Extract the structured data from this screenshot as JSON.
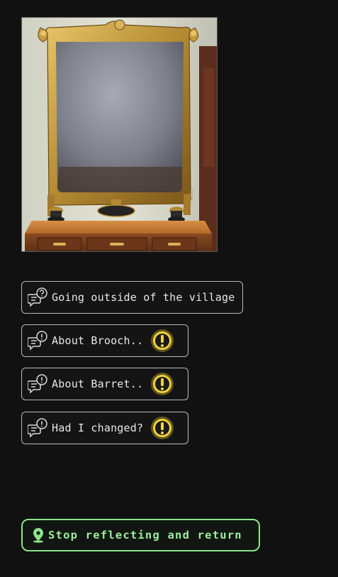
{
  "scene": {
    "image_icon": "ornate-vanity-mirror-illustration"
  },
  "choices": [
    {
      "label": "Going outside of the village",
      "icon": "chat-question-icon",
      "alert": false
    },
    {
      "label": "About Brooch..",
      "icon": "chat-exclamation-icon",
      "alert": true
    },
    {
      "label": "About Barret..",
      "icon": "chat-exclamation-icon",
      "alert": true
    },
    {
      "label": "Had I changed?",
      "icon": "chat-exclamation-icon",
      "alert": true
    }
  ],
  "return_action": {
    "label": "Stop reflecting and return",
    "icon": "map-pin-icon"
  },
  "colors": {
    "background": "#111111",
    "choice_border": "#b9b9b9",
    "alert_gold": "#f2d23a",
    "return_green": "#8ae58a"
  }
}
